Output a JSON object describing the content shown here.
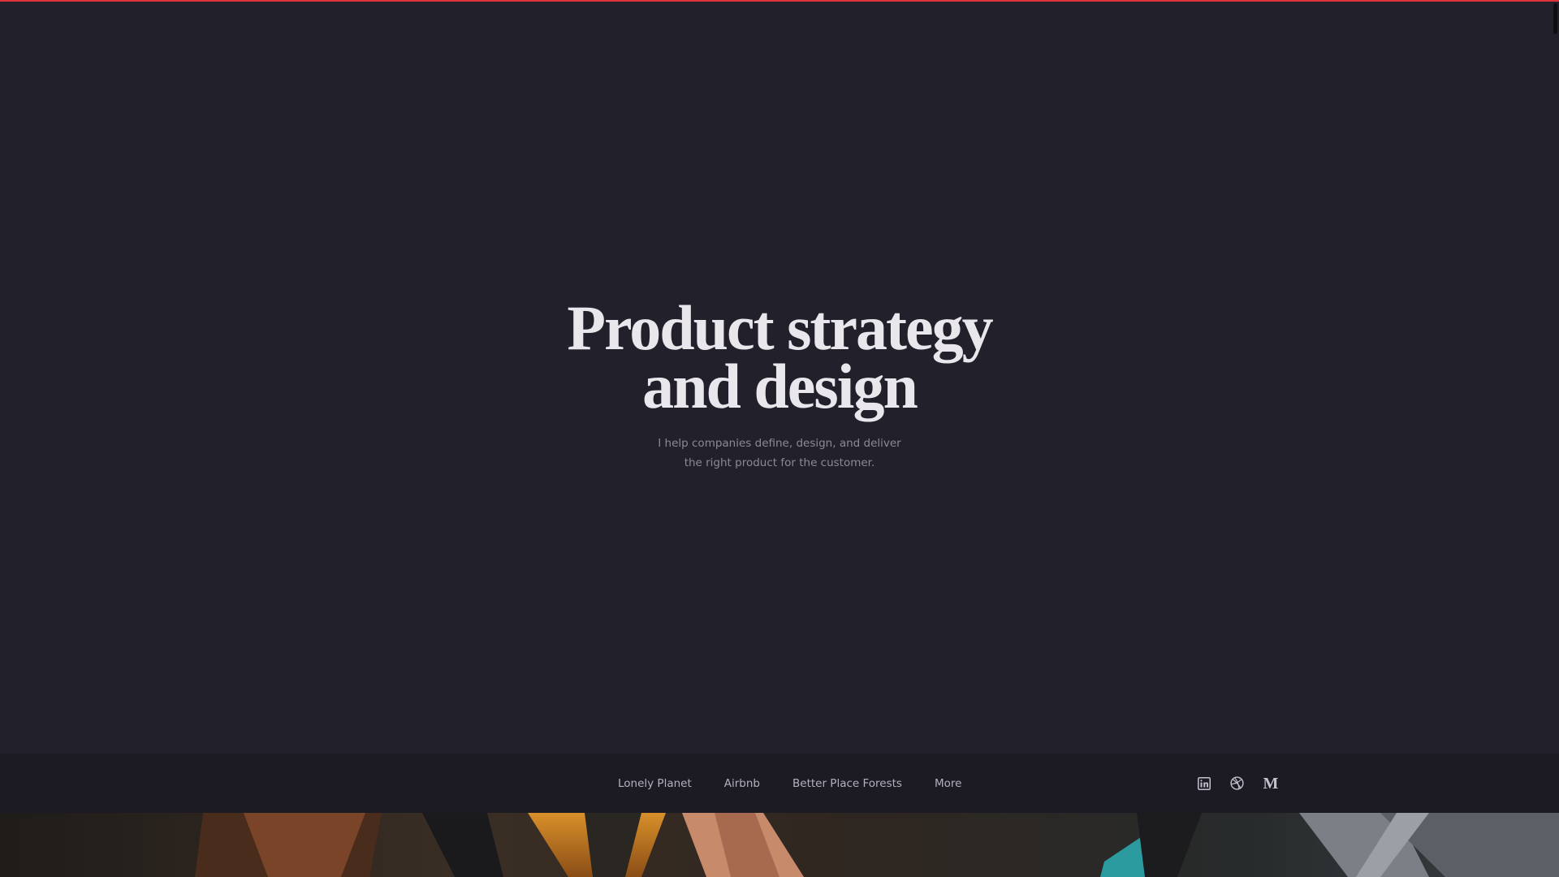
{
  "hero": {
    "title": "Product strategy\nand design",
    "subtitle": "I help companies define, design, and deliver\nthe right product for the customer."
  },
  "nav": {
    "links": [
      {
        "label": "Lonely Planet"
      },
      {
        "label": "Airbnb"
      },
      {
        "label": "Better Place Forests"
      },
      {
        "label": "More"
      }
    ],
    "social_icons": [
      {
        "icon": "linkedin-icon"
      },
      {
        "icon": "dribbble-icon"
      },
      {
        "icon": "medium-icon",
        "glyph": "M"
      }
    ]
  },
  "colors": {
    "background": "#21202b",
    "navbar": "#1c1b24",
    "accent": "#e0323c",
    "title": "#e9e7ec",
    "subtitle": "#8c8a97",
    "nav_text": "#b3b1bd"
  }
}
